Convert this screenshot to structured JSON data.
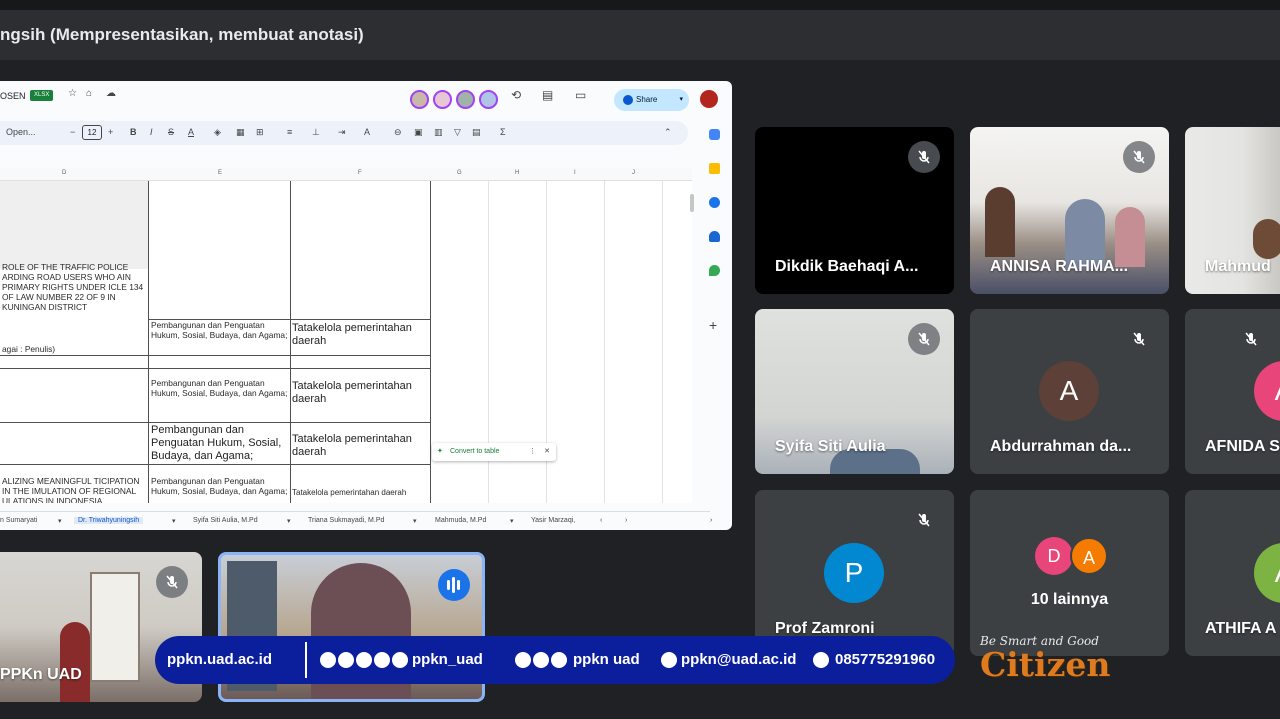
{
  "meeting": {
    "title": "ngsih (Mempresentasikan, membuat anotasi)"
  },
  "sheet": {
    "doc_name": "OSEN",
    "badge": "XLSX",
    "share_label": "Share",
    "font_name": "Open...",
    "font_size": "12",
    "columns": [
      "D",
      "E",
      "F",
      "G",
      "H",
      "I",
      "J"
    ],
    "rows": [
      {
        "col_d": "ROLE OF THE TRAFFIC POLICE ARDING ROAD USERS WHO AIN PRIMARY RIGHTS UNDER ICLE 134 OF LAW NUMBER 22 OF 9 IN KUNINGAN DISTRICT",
        "col_d2": "agai : Penulis)",
        "col_e": "Pembangunan dan Penguatan Hukum, Sosial, Budaya, dan Agama;",
        "col_f": "Tatakelola pemerintahan daerah"
      },
      {
        "col_e": "Pembangunan dan Penguatan Hukum, Sosial, Budaya, dan Agama;",
        "col_f": "Tatakelola pemerintahan daerah"
      },
      {
        "col_e": "Pembangunan dan Penguatan Hukum, Sosial, Budaya, dan Agama;",
        "col_f": "Tatakelola pemerintahan daerah"
      },
      {
        "col_d": "ALIZING MEANINGFUL TICIPATION IN THE IMULATION OF REGIONAL ULATIONS IN INDONESIA",
        "col_e": "Pembangunan dan Penguatan Hukum, Sosial, Budaya, dan Agama;",
        "col_f": "Tatakelola pemerintahan daerah"
      }
    ],
    "convert_label": "Convert to table",
    "tabs": [
      {
        "label": "n Sumaryati",
        "active": false
      },
      {
        "label": "Dr. Triwahyuningsih",
        "active": true
      },
      {
        "label": "Syifa Siti Aulia, M.Pd",
        "active": false
      },
      {
        "label": "Triana Sukmayadi, M.Pd",
        "active": false
      },
      {
        "label": "Mahmuda, M.Pd",
        "active": false
      },
      {
        "label": "Yasir Marzaqi,",
        "active": false
      }
    ]
  },
  "participants": [
    {
      "name": "Dikdik Baehaqi A...",
      "muted": true
    },
    {
      "name": "ANNISA RAHMA...",
      "muted": true
    },
    {
      "name": "Mahmud",
      "muted": false
    },
    {
      "name": "Syifa Siti Aulia",
      "muted": true
    },
    {
      "name": "Abdurrahman da...",
      "muted": true,
      "initial": "A",
      "color": "#5d4037"
    },
    {
      "name": "AFNIDA S",
      "muted": true,
      "initial": "A",
      "color": "#e8457a"
    },
    {
      "name": "Prof Zamroni",
      "muted": true,
      "initial": "P",
      "color": "#0288d1"
    },
    {
      "name": "10 lainnya",
      "initials": [
        "D",
        "A"
      ],
      "colors": [
        "#e8457a",
        "#f57c00"
      ]
    },
    {
      "name": "ATHIFA A",
      "initial": "A",
      "color": "#7cb342"
    },
    {
      "name": "PPKn UAD",
      "muted": true
    },
    {
      "name": "",
      "speaking": true
    }
  ],
  "banner": {
    "url": "ppkn.uad.ac.id",
    "handle1": "ppkn_uad",
    "handle2": "ppkn uad",
    "email": "ppkn@uad.ac.id",
    "phone": "085775291960",
    "slogan": "Be Smart and Good",
    "brand": "Citizen"
  },
  "colors": {
    "background": "#202124",
    "tile": "#3c4043",
    "banner": "#0b1f9c",
    "brand": "#e07a1f",
    "speaking_border": "#8ab4f8"
  }
}
